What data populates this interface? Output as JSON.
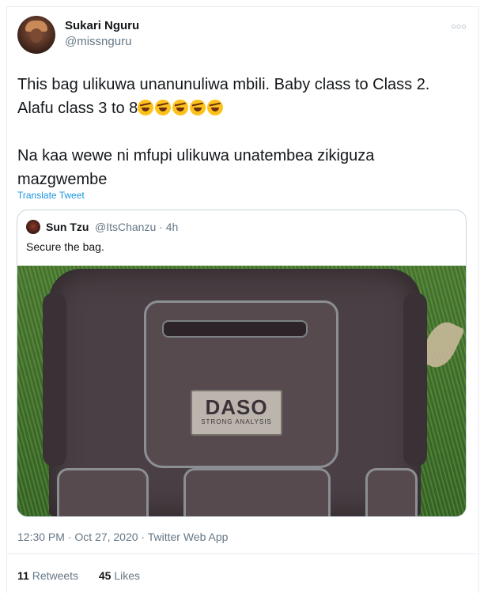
{
  "author": {
    "name": "Sukari Nguru",
    "handle": "@missnguru"
  },
  "more_icon": "more-dots-icon",
  "tweet": {
    "line1": "This bag ulikuwa unanunuliwa mbili. Baby class to Class 2. Alafu class 3 to 8",
    "emoji_count": 5,
    "emoji_icon": "rolling-on-floor-laughing-icon",
    "line2": "Na kaa wewe ni mfupi ulikuwa unatembea zikiguza mazgwembe"
  },
  "translate_label": "Translate Tweet",
  "quoted": {
    "name": "Sun Tzu",
    "meta": "@ItsChanzu · 4h",
    "text": "Secure the bag.",
    "photo": {
      "brand_main": "DASO",
      "brand_sub": "STRONG ANALYSIS"
    }
  },
  "footer": {
    "meta": "12:30 PM · Oct 27, 2020 · Twitter Web App"
  },
  "stats": {
    "retweets_count": "11",
    "retweets_label": "Retweets",
    "likes_count": "45",
    "likes_label": "Likes"
  },
  "colors": {
    "link": "#1b95e0",
    "muted": "#657786",
    "border": "#ccd6dd"
  }
}
